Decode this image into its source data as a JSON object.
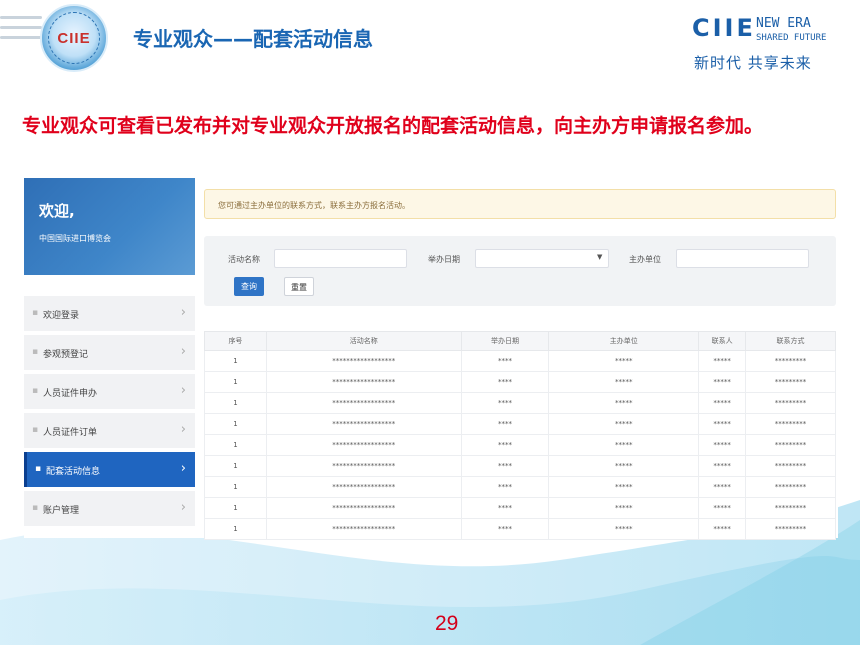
{
  "slide": {
    "title": "专业观众——配套活动信息",
    "headline": "专业观众可查看已发布并对专业观众开放报名的配套活动信息，向主办方申请报名参加。",
    "page_number": "29",
    "logo": "CIIE",
    "brand": {
      "name": "CIIE",
      "tag1": "NEW ERA",
      "tag2": "SHARED FUTURE",
      "slogan": "新时代 共享未来"
    },
    "colors": {
      "title": "#1a66b3",
      "headline": "#e0001b",
      "accent": "#1f65c0"
    }
  },
  "app": {
    "welcome": {
      "greeting": "欢迎,",
      "org": "中国国际进口博览会"
    },
    "menu": [
      {
        "label": "欢迎登录"
      },
      {
        "label": "参观预登记"
      },
      {
        "label": "人员证件申办"
      },
      {
        "label": "人员证件订单"
      },
      {
        "label": "配套活动信息",
        "active": true
      },
      {
        "label": "账户管理"
      }
    ],
    "notice": "您可通过主办单位的联系方式，联系主办方报名活动。",
    "filter": {
      "activity_name_label": "活动名称",
      "date_label": "举办日期",
      "organizer_label": "主办单位",
      "activity_name_value": "",
      "date_value": "",
      "organizer_value": "",
      "search_button": "查询",
      "reset_button": "重置"
    },
    "table": {
      "headers": [
        "序号",
        "活动名称",
        "举办日期",
        "主办单位",
        "联系人",
        "联系方式"
      ],
      "rows": [
        [
          "1",
          "******************",
          "****",
          "*****",
          "*****",
          "*********"
        ],
        [
          "1",
          "******************",
          "****",
          "*****",
          "*****",
          "*********"
        ],
        [
          "1",
          "******************",
          "****",
          "*****",
          "*****",
          "*********"
        ],
        [
          "1",
          "******************",
          "****",
          "*****",
          "*****",
          "*********"
        ],
        [
          "1",
          "******************",
          "****",
          "*****",
          "*****",
          "*********"
        ],
        [
          "1",
          "******************",
          "****",
          "*****",
          "*****",
          "*********"
        ],
        [
          "1",
          "******************",
          "****",
          "*****",
          "*****",
          "*********"
        ],
        [
          "1",
          "******************",
          "****",
          "*****",
          "*****",
          "*********"
        ],
        [
          "1",
          "******************",
          "****",
          "*****",
          "*****",
          "*********"
        ]
      ]
    }
  }
}
